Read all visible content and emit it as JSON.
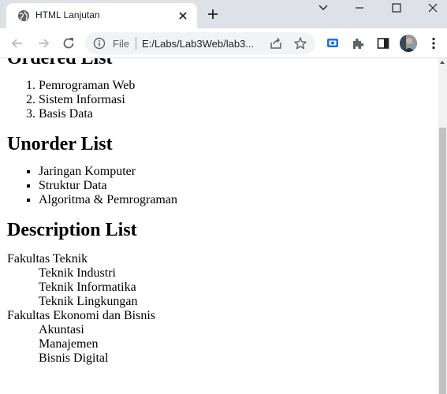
{
  "browser": {
    "tab_title": "HTML Lanjutan",
    "omnibox": {
      "scheme_label": "File",
      "url": "E:/Labs/Lab3Web/lab3..."
    },
    "icons": {
      "tab": "globe-icon",
      "close": "close-icon",
      "new_tab": "plus-icon",
      "back": "arrow-left-icon",
      "forward": "arrow-right-icon",
      "reload": "reload-icon",
      "info": "info-icon",
      "share": "share-icon",
      "bookmark": "star-icon",
      "cast": "cast-icon",
      "extensions": "puzzle-icon",
      "side_panel": "side-panel-icon",
      "menu": "kebab-menu-icon"
    },
    "colors": {
      "titlebar": "#dee1e6",
      "omnibox": "#f1f3f4",
      "accent": "#1a73e8"
    }
  },
  "page": {
    "ordered": {
      "heading": "Ordered List",
      "items": [
        "Pemrograman Web",
        "Sistem Informasi",
        "Basis Data"
      ]
    },
    "unordered": {
      "heading": "Unorder List",
      "items": [
        "Jaringan Komputer",
        "Struktur Data",
        "Algoritma & Pemrograman"
      ]
    },
    "description": {
      "heading": "Description List",
      "groups": [
        {
          "term": "Fakultas Teknik",
          "definitions": [
            "Teknik Industri",
            "Teknik Informatika",
            "Teknik Lingkungan"
          ]
        },
        {
          "term": "Fakultas Ekonomi dan Bisnis",
          "definitions": [
            "Akuntasi",
            "Manajemen",
            "Bisnis Digital"
          ]
        }
      ]
    }
  }
}
